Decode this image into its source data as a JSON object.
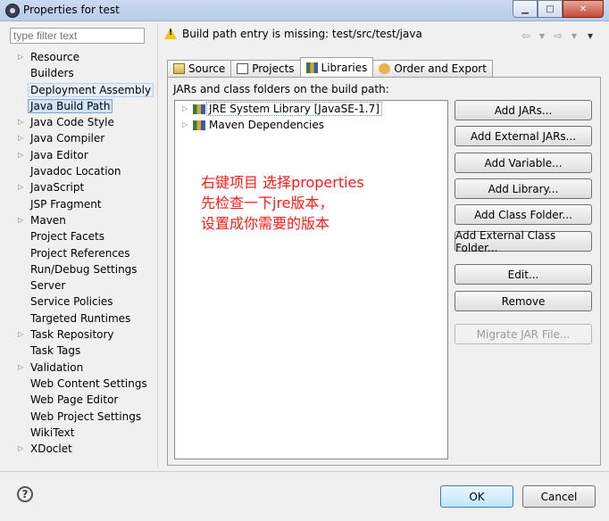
{
  "window": {
    "title": "Properties for test"
  },
  "filter": {
    "placeholder": "type filter text"
  },
  "nav": {
    "items": [
      {
        "label": "Resource",
        "expandable": true
      },
      {
        "label": "Builders",
        "expandable": false
      },
      {
        "label": "Deployment Assembly",
        "expandable": false
      },
      {
        "label": "Java Build Path",
        "expandable": false
      },
      {
        "label": "Java Code Style",
        "expandable": true
      },
      {
        "label": "Java Compiler",
        "expandable": true
      },
      {
        "label": "Java Editor",
        "expandable": true
      },
      {
        "label": "Javadoc Location",
        "expandable": false
      },
      {
        "label": "JavaScript",
        "expandable": true
      },
      {
        "label": "JSP Fragment",
        "expandable": false
      },
      {
        "label": "Maven",
        "expandable": true
      },
      {
        "label": "Project Facets",
        "expandable": false
      },
      {
        "label": "Project References",
        "expandable": false
      },
      {
        "label": "Run/Debug Settings",
        "expandable": false
      },
      {
        "label": "Server",
        "expandable": false
      },
      {
        "label": "Service Policies",
        "expandable": false
      },
      {
        "label": "Targeted Runtimes",
        "expandable": false
      },
      {
        "label": "Task Repository",
        "expandable": true
      },
      {
        "label": "Task Tags",
        "expandable": false
      },
      {
        "label": "Validation",
        "expandable": true
      },
      {
        "label": "Web Content Settings",
        "expandable": false
      },
      {
        "label": "Web Page Editor",
        "expandable": false
      },
      {
        "label": "Web Project Settings",
        "expandable": false
      },
      {
        "label": "WikiText",
        "expandable": false
      },
      {
        "label": "XDoclet",
        "expandable": true
      }
    ]
  },
  "header": {
    "message": "Build path entry is missing: test/src/test/java"
  },
  "tabs": [
    {
      "label": "Source"
    },
    {
      "label": "Projects"
    },
    {
      "label": "Libraries"
    },
    {
      "label": "Order and Export"
    }
  ],
  "libraries": {
    "label": "JARs and class folders on the build path:",
    "entries": [
      {
        "label": "JRE System Library [JavaSE-1.7]"
      },
      {
        "label": "Maven Dependencies"
      }
    ],
    "buttons": {
      "add_jars": "Add JARs...",
      "add_external_jars": "Add External JARs...",
      "add_variable": "Add Variable...",
      "add_library": "Add Library...",
      "add_class_folder": "Add Class Folder...",
      "add_external_class_folder": "Add External Class Folder...",
      "edit": "Edit...",
      "remove": "Remove",
      "migrate_jar": "Migrate JAR File..."
    }
  },
  "annotation": {
    "line1": "右键项目 选择properties",
    "line2": "先检查一下jre版本，",
    "line3": "设置成你需要的版本"
  },
  "footer": {
    "ok": "OK",
    "cancel": "Cancel",
    "help": "?"
  }
}
